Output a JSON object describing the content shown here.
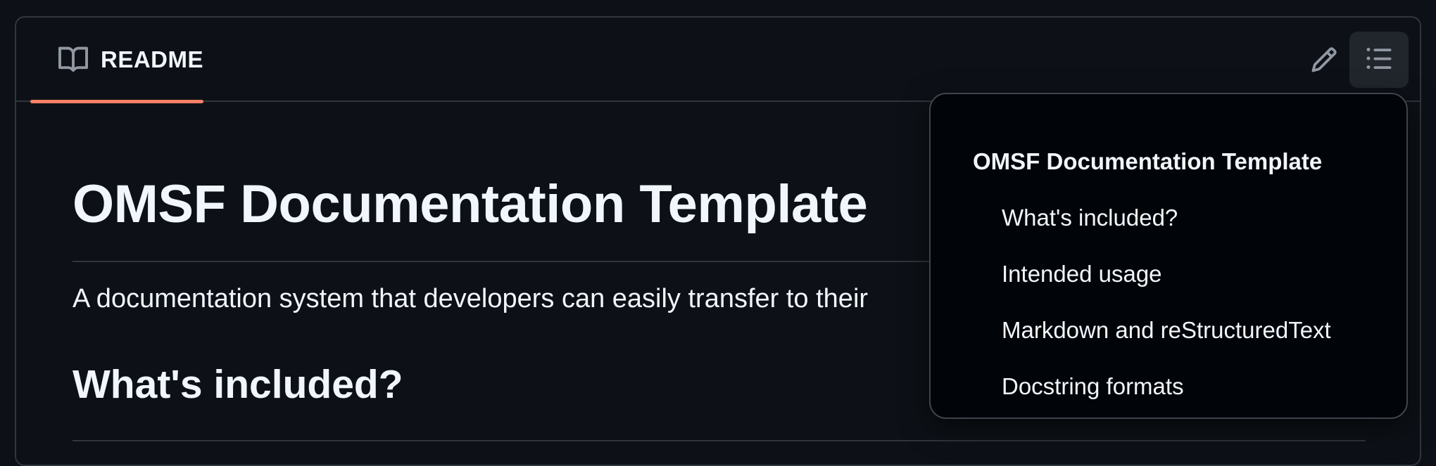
{
  "readme": {
    "tab_label": "README",
    "tab_icon": "book-icon",
    "edit_icon": "pencil-icon",
    "toc_icon": "list-unordered-icon"
  },
  "article": {
    "title": "OMSF Documentation Template",
    "intro": "A documentation system that developers can easily transfer to their",
    "section_heading": "What's included?"
  },
  "toc": {
    "items": [
      {
        "label": "OMSF Documentation Template",
        "level": 1
      },
      {
        "label": "What's included?",
        "level": 2
      },
      {
        "label": "Intended usage",
        "level": 2
      },
      {
        "label": "Markdown and reStructuredText",
        "level": 2
      },
      {
        "label": "Docstring formats",
        "level": 2
      }
    ]
  },
  "colors": {
    "background": "#0d1117",
    "border": "#30363d",
    "tab_accent": "#f78166",
    "text": "#f0f6fc",
    "icon_muted": "#9198a1",
    "popover_bg": "#010409"
  }
}
